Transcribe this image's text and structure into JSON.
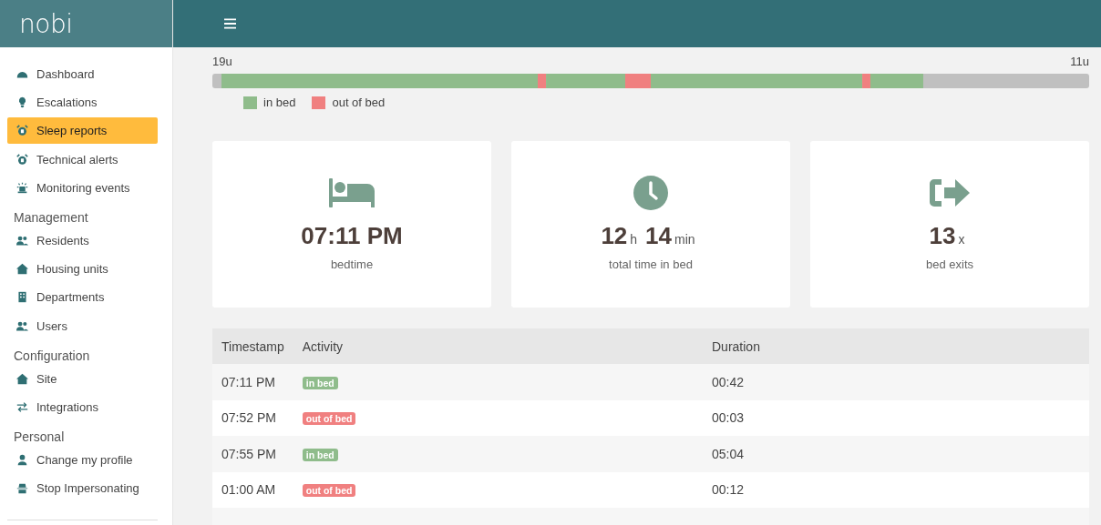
{
  "logo": "nobi",
  "sidebar": {
    "sections": [
      {
        "items": [
          {
            "label": "Dashboard",
            "selected": false
          },
          {
            "label": "Escalations",
            "selected": false
          },
          {
            "label": "Sleep reports",
            "selected": true
          },
          {
            "label": "Technical alerts",
            "selected": false
          },
          {
            "label": "Monitoring events",
            "selected": false
          }
        ]
      },
      {
        "heading": "Management",
        "items": [
          {
            "label": "Residents",
            "selected": false
          },
          {
            "label": "Housing units",
            "selected": false
          },
          {
            "label": "Departments",
            "selected": false
          },
          {
            "label": "Users",
            "selected": false
          }
        ]
      },
      {
        "heading": "Configuration",
        "items": [
          {
            "label": "Site",
            "selected": false
          },
          {
            "label": "Integrations",
            "selected": false
          }
        ]
      },
      {
        "heading": "Personal",
        "items": [
          {
            "label": "Change my profile",
            "selected": false
          },
          {
            "label": "Stop Impersonating",
            "selected": false
          }
        ]
      }
    ]
  },
  "timeline": {
    "start_label": "19u",
    "end_label": "11u",
    "legend": [
      {
        "label": "in bed",
        "color": "#8fbc8b"
      },
      {
        "label": "out of bed",
        "color": "#f08080"
      }
    ]
  },
  "cards": [
    {
      "parts": [
        {
          "value": "07:11 PM"
        }
      ],
      "caption": "bedtime"
    },
    {
      "parts": [
        {
          "value": "12",
          "unit": "h"
        },
        {
          "value": "14",
          "unit": "min"
        }
      ],
      "caption": "total time in bed"
    },
    {
      "parts": [
        {
          "value": "13",
          "unit": "x"
        }
      ],
      "caption": "bed exits"
    }
  ],
  "table": {
    "columns": [
      "Timestamp",
      "Activity",
      "Duration"
    ],
    "rows": [
      {
        "timestamp": "07:11 PM",
        "activity": "in bed",
        "kind": "in",
        "duration": "00:42"
      },
      {
        "timestamp": "07:52 PM",
        "activity": "out of bed",
        "kind": "out",
        "duration": "00:03"
      },
      {
        "timestamp": "07:55 PM",
        "activity": "in bed",
        "kind": "in",
        "duration": "05:04"
      },
      {
        "timestamp": "01:00 AM",
        "activity": "out of bed",
        "kind": "out",
        "duration": "00:12"
      }
    ]
  }
}
